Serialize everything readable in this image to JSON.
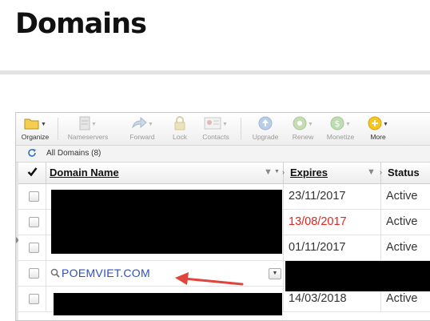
{
  "page": {
    "title": "Domains"
  },
  "toolbar": {
    "items": [
      {
        "label": "Organize",
        "icon": "folder-icon",
        "enabled": true
      },
      {
        "label": "Nameservers",
        "icon": "server-icon",
        "enabled": false
      },
      {
        "label": "Forward",
        "icon": "forward-icon",
        "enabled": false
      },
      {
        "label": "Lock",
        "icon": "lock-icon",
        "enabled": false
      },
      {
        "label": "Contacts",
        "icon": "contact-card-icon",
        "enabled": false
      },
      {
        "label": "Upgrade",
        "icon": "upgrade-icon",
        "enabled": false
      },
      {
        "label": "Renew",
        "icon": "renew-icon",
        "enabled": false
      },
      {
        "label": "Monetize",
        "icon": "dollar-icon",
        "enabled": false
      },
      {
        "label": "More",
        "icon": "plus-circle-icon",
        "enabled": true
      }
    ]
  },
  "subbar": {
    "filter_label": "All Domains (8)"
  },
  "table": {
    "columns": {
      "domain": "Domain Name",
      "expires": "Expires",
      "status": "Status"
    },
    "rows": [
      {
        "domain": "",
        "expires": "23/11/2017",
        "status": "Active",
        "expired": false
      },
      {
        "domain": "",
        "expires": "13/08/2017",
        "status": "Active",
        "expired": true
      },
      {
        "domain": "",
        "expires": "01/11/2017",
        "status": "Active",
        "expired": false
      },
      {
        "domain": "POEMVIET.COM",
        "expires": "",
        "status": "",
        "expired": false
      },
      {
        "domain": "",
        "expires": "14/03/2018",
        "status": "Active",
        "expired": false
      }
    ]
  },
  "colors": {
    "link": "#2a52be",
    "expired": "#e0261c",
    "arrow": "#e0443a"
  }
}
